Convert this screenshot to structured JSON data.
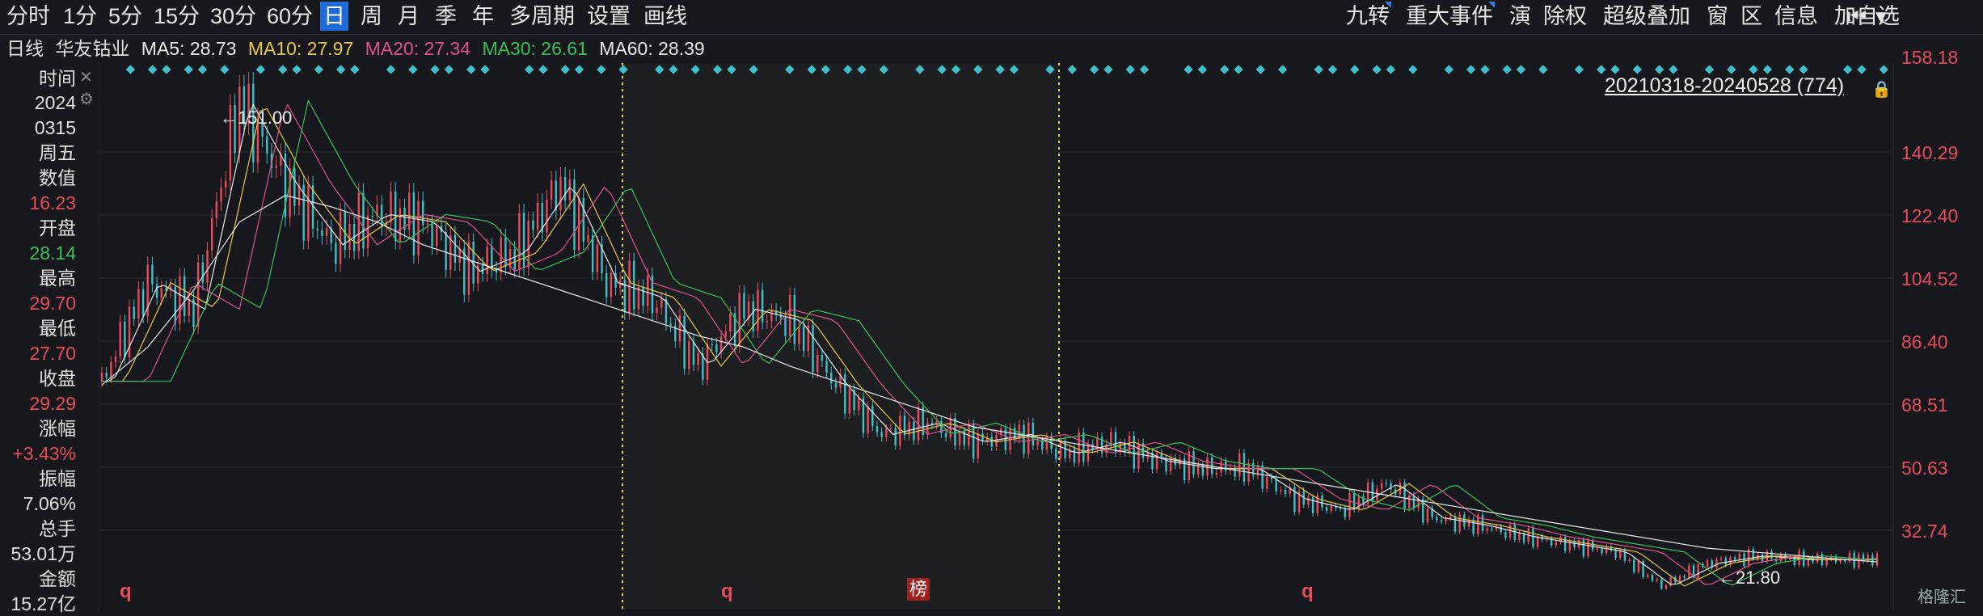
{
  "toolbar": {
    "periods": [
      "分时",
      "1分",
      "5分",
      "15分",
      "30分",
      "60分",
      "日",
      "周",
      "月",
      "季",
      "年",
      "多周期",
      "设置",
      "画线"
    ],
    "active_period": "日",
    "right_tools": [
      "九转",
      "重大事件",
      "演",
      "除权",
      "超级叠加",
      "窗",
      "区",
      "信息",
      "加自选"
    ]
  },
  "indicator_bar": {
    "period_label": "日线",
    "stock_name": "华友钴业",
    "ma5": "MA5: 28.73",
    "ma10": "MA10: 27.97",
    "ma20": "MA20: 27.34",
    "ma30": "MA30: 26.61",
    "ma60": "MA60: 28.39",
    "colors": {
      "ma5": "#e8e8e8",
      "ma10": "#e8c84a",
      "ma20": "#e0508a",
      "ma30": "#3bbf5a",
      "ma60": "#e8e8e8"
    }
  },
  "info_panel": {
    "time_label": "时间",
    "year": "2024",
    "date": "0315",
    "weekday": "周五",
    "value_label": "数值",
    "value": "16.23",
    "open_label": "开盘",
    "open": "28.14",
    "high_label": "最高",
    "high": "29.70",
    "low_label": "最低",
    "low": "27.70",
    "close_label": "收盘",
    "close": "29.29",
    "change_label": "涨幅",
    "change": "+3.43%",
    "amplitude_label": "振幅",
    "amplitude": "7.06%",
    "volume_label": "总手",
    "volume": "53.01万",
    "amount_label": "金额",
    "amount": "15.27亿"
  },
  "chart_meta": {
    "range": "20210318-20240528 (774)",
    "max_label": "151.00",
    "min_label": "21.80",
    "ticks": [
      "158.18",
      "140.29",
      "122.40",
      "104.52",
      "86.40",
      "68.51",
      "50.63",
      "32.74"
    ],
    "markers": [
      "q",
      "q",
      "q"
    ],
    "bang_label": "榜",
    "logo": "格隆汇",
    "up_color": "#e84b5b",
    "down_color": "#3ec1c8",
    "grid_color": "#2a2d33"
  },
  "chart_data": {
    "type": "line",
    "title": "",
    "ylabel": "",
    "ylim": [
      21.8,
      158.18
    ],
    "x": [
      0,
      20,
      40,
      60,
      80,
      100,
      120,
      140,
      160,
      180,
      200,
      220,
      240,
      260,
      280,
      300,
      320,
      340,
      360,
      380,
      400,
      420,
      440,
      460,
      480,
      500,
      520,
      540,
      560,
      580,
      600,
      620,
      640,
      660,
      680,
      700,
      720,
      740,
      760,
      774
    ],
    "series": [
      {
        "name": "MA60",
        "values": [
          75,
          85,
          100,
          118,
          125,
          122,
          118,
          112,
          108,
          104,
          100,
          96,
          92,
          88,
          85,
          80,
          76,
          72,
          68,
          64,
          62,
          60,
          58,
          56,
          54,
          52,
          50,
          48,
          46,
          44,
          42,
          40,
          38,
          36,
          34,
          32,
          31,
          30,
          29,
          28.4
        ]
      }
    ],
    "close": [
      76,
      102,
      95,
      150,
      128,
      112,
      120,
      118,
      105,
      110,
      128,
      102,
      98,
      80,
      95,
      92,
      75,
      62,
      65,
      60,
      62,
      57,
      60,
      55,
      53,
      53,
      45,
      42,
      49,
      40,
      38,
      35,
      33,
      31,
      22,
      28,
      30,
      29,
      29,
      29.3
    ]
  }
}
